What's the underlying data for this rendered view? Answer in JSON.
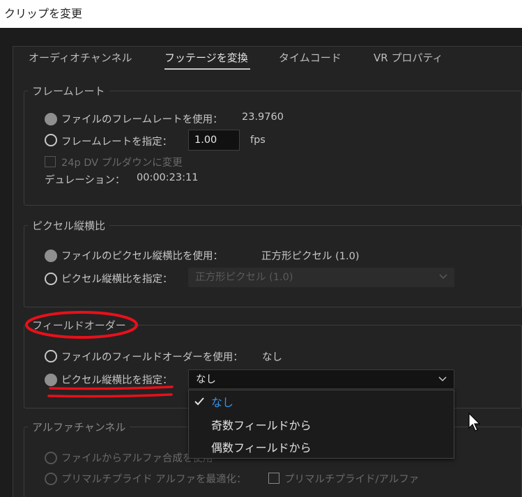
{
  "window": {
    "title": "クリップを変更"
  },
  "tabs": [
    {
      "label": "オーディオチャンネル",
      "active": false
    },
    {
      "label": "フッテージを変換",
      "active": true
    },
    {
      "label": "タイムコード",
      "active": false
    },
    {
      "label": "VR プロパティ",
      "active": false
    }
  ],
  "frame_rate": {
    "title": "フレームレート",
    "use_file_label": "ファイルのフレームレートを使用：",
    "use_file_value": "23.9760",
    "assume_label": "フレームレートを指定：",
    "assume_value": "1.00",
    "assume_unit": "fps",
    "pulldown_label": "24p DV プルダウンに変更",
    "duration_label": "デュレーション：",
    "duration_value": "00:00:23:11"
  },
  "pixel_aspect": {
    "title": "ピクセル縦横比",
    "use_file_label": "ファイルのピクセル縦横比を使用：",
    "use_file_value": "正方形ピクセル (1.0)",
    "conform_label": "ピクセル縦横比を指定：",
    "conform_value": "正方形ピクセル (1.0)"
  },
  "field_order": {
    "title": "フィールドオーダー",
    "use_file_label": "ファイルのフィールドオーダーを使用：",
    "use_file_value": "なし",
    "conform_label": "ピクセル縦横比を指定：",
    "conform_value": "なし",
    "menu_options": [
      "なし",
      "奇数フィールドから",
      "偶数フィールドから"
    ],
    "menu_selected": "なし"
  },
  "alpha": {
    "title": "アルファチャンネル",
    "interpret_label": "ファイルからアルファ合成を使用",
    "premultiply_label": "プリマルチプライド アルファを最適化：",
    "premultiply_check_label": "プリマルチプライド/アルファ"
  },
  "colors": {
    "accent_selected": "#3a94e6",
    "annotation_red": "#e8101a"
  }
}
